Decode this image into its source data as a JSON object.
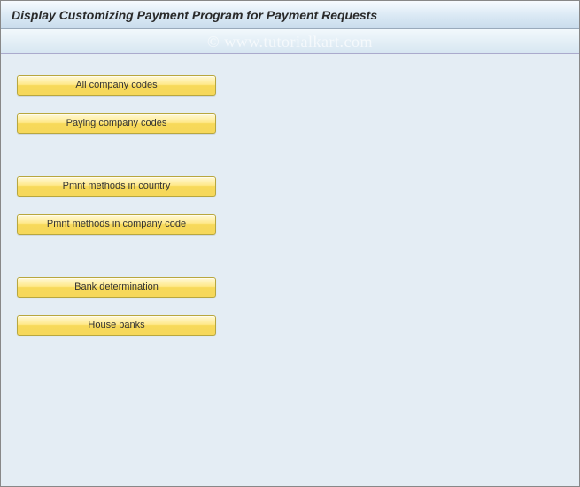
{
  "header": {
    "title": "Display Customizing Payment Program for Payment Requests"
  },
  "watermark": {
    "text": "© www.tutorialkart.com"
  },
  "buttons": {
    "all_company_codes": "All company codes",
    "paying_company_codes": "Paying company codes",
    "pmnt_methods_country": "Pmnt methods in country",
    "pmnt_methods_company": "Pmnt methods in company code",
    "bank_determination": "Bank determination",
    "house_banks": "House banks"
  }
}
